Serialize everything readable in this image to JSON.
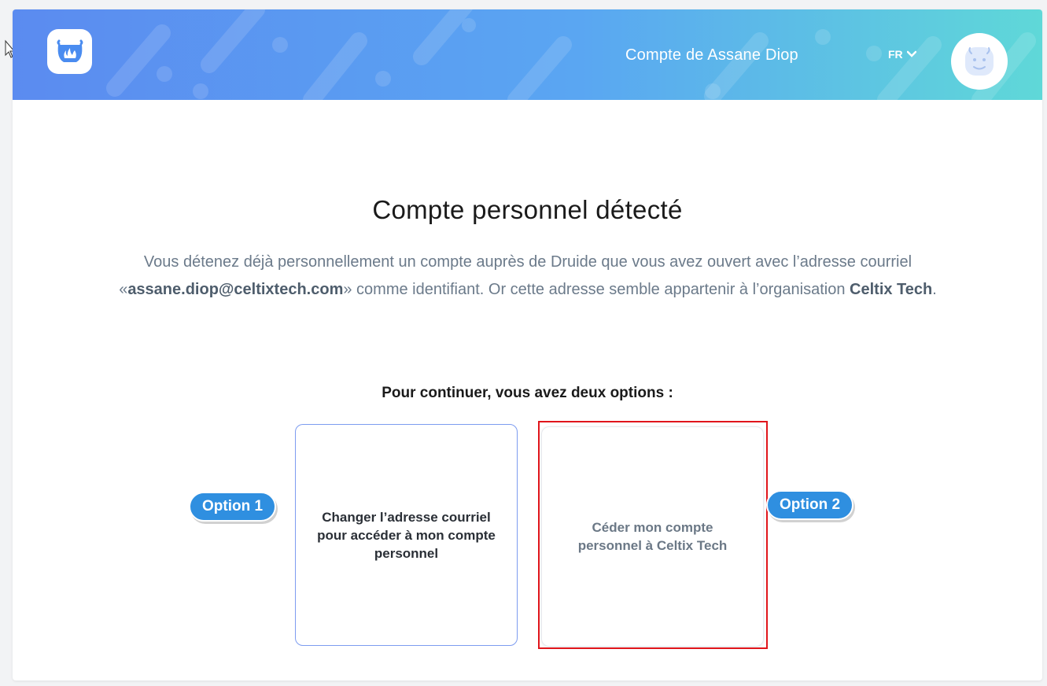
{
  "header": {
    "account_name": "Compte de Assane Diop",
    "language": "FR",
    "logo_icon": "cauldron-logo-icon",
    "avatar_icon": "druid-avatar-icon"
  },
  "main": {
    "title": "Compte personnel détecté",
    "description": {
      "part1": "Vous détenez déjà personnellement un compte auprès de Druide que vous avez ouvert avec l’adresse courriel «",
      "email": "assane.diop@celtixtech.com",
      "part2": "» comme identifiant. Or cette adresse semble appartenir à l’organisation ",
      "organization": "Celtix Tech",
      "part3": "."
    },
    "options_heading": "Pour continuer, vous avez deux options :",
    "options": [
      {
        "badge": "Option 1",
        "label": "Changer l’adresse courriel pour accéder à mon compte personnel"
      },
      {
        "badge": "Option 2",
        "label": "Céder mon compte personnel à Celtix Tech"
      }
    ]
  },
  "colors": {
    "header_gradient_start": "#5b8bf0",
    "header_gradient_end": "#5fd8d8",
    "badge_blue": "#2f8fe0",
    "highlight_red": "#e0151b",
    "option1_border": "#7d9cf0"
  }
}
